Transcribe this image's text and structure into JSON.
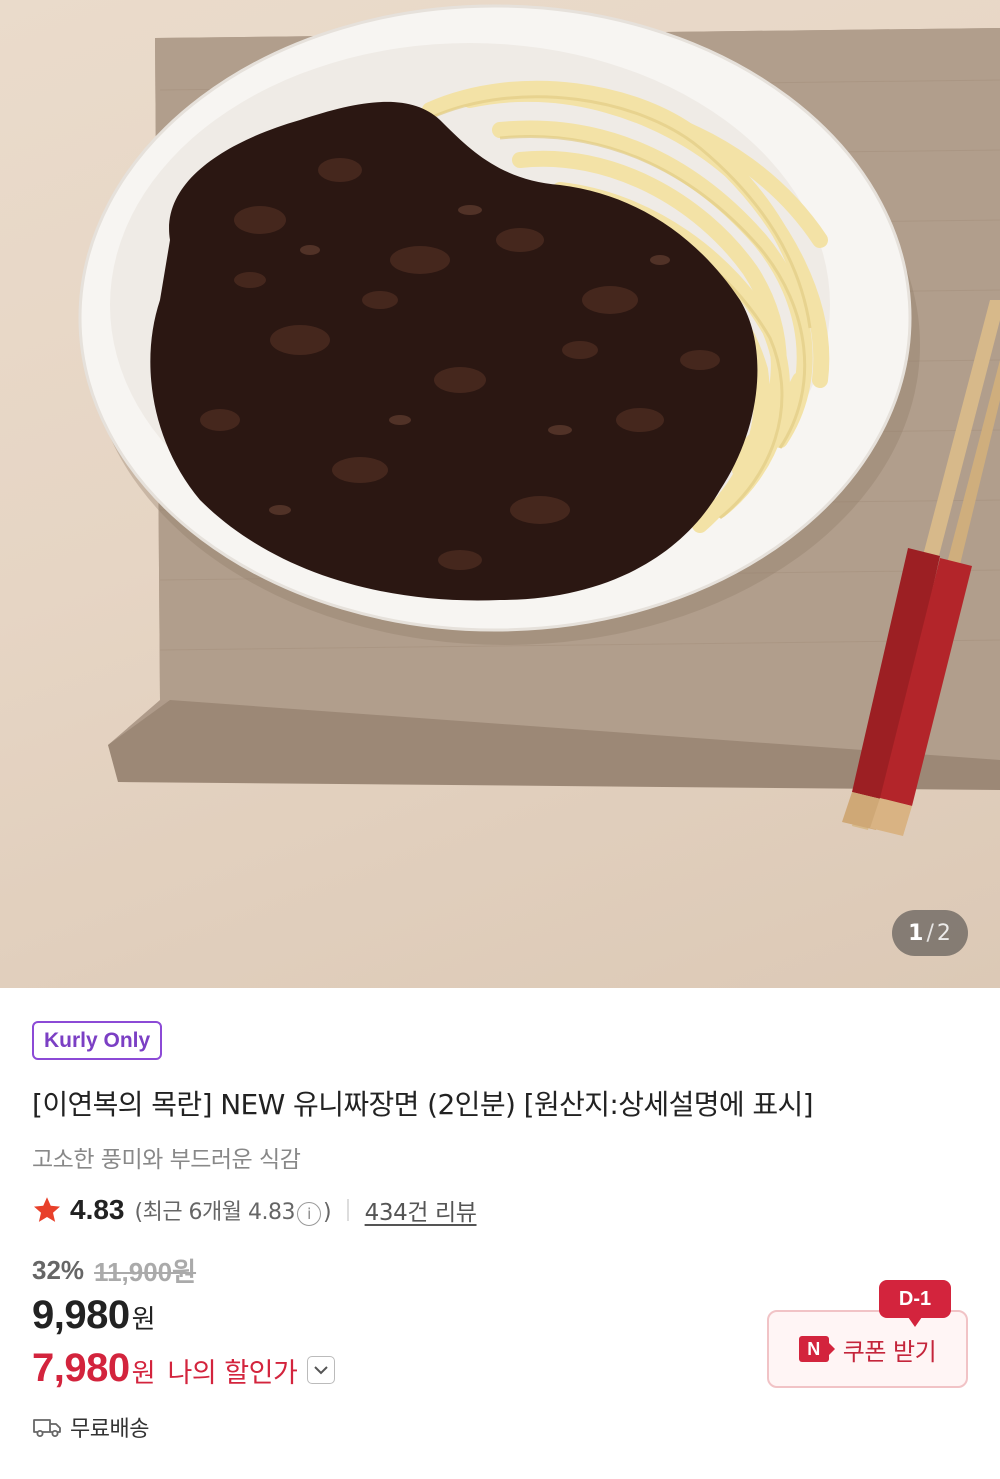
{
  "product_image": {
    "alt": "",
    "pager": {
      "current": "1",
      "separator": "/",
      "total": "2"
    }
  },
  "product": {
    "badge": "Kurly Only",
    "title": "[이연복의 목란] NEW 유니짜장면 (2인분) [원산지:상세설명에 표시]",
    "subtitle": "고소한 풍미와 부드러운 식감"
  },
  "rating": {
    "score": "4.83",
    "recent_prefix": "(최근 6개월 4.83",
    "recent_suffix": ")",
    "info_glyph": "i",
    "reviews": "434건 리뷰"
  },
  "price": {
    "discount_rate": "32%",
    "original": "11,900원",
    "sale": "9,980",
    "currency": "원",
    "my_price": "7,980",
    "my_price_label": "나의 할인가"
  },
  "coupon": {
    "dday": "D-1",
    "n_label": "N",
    "label": "쿠폰 받기"
  },
  "delivery": {
    "label": "무료배송"
  },
  "colors": {
    "accent_red": "#d3243d",
    "badge_purple": "#7b3fc4",
    "star": "#e8402a"
  },
  "icons": {
    "star": "star-icon",
    "info": "info-icon",
    "chevron": "chevron-down-icon",
    "truck": "truck-icon"
  }
}
